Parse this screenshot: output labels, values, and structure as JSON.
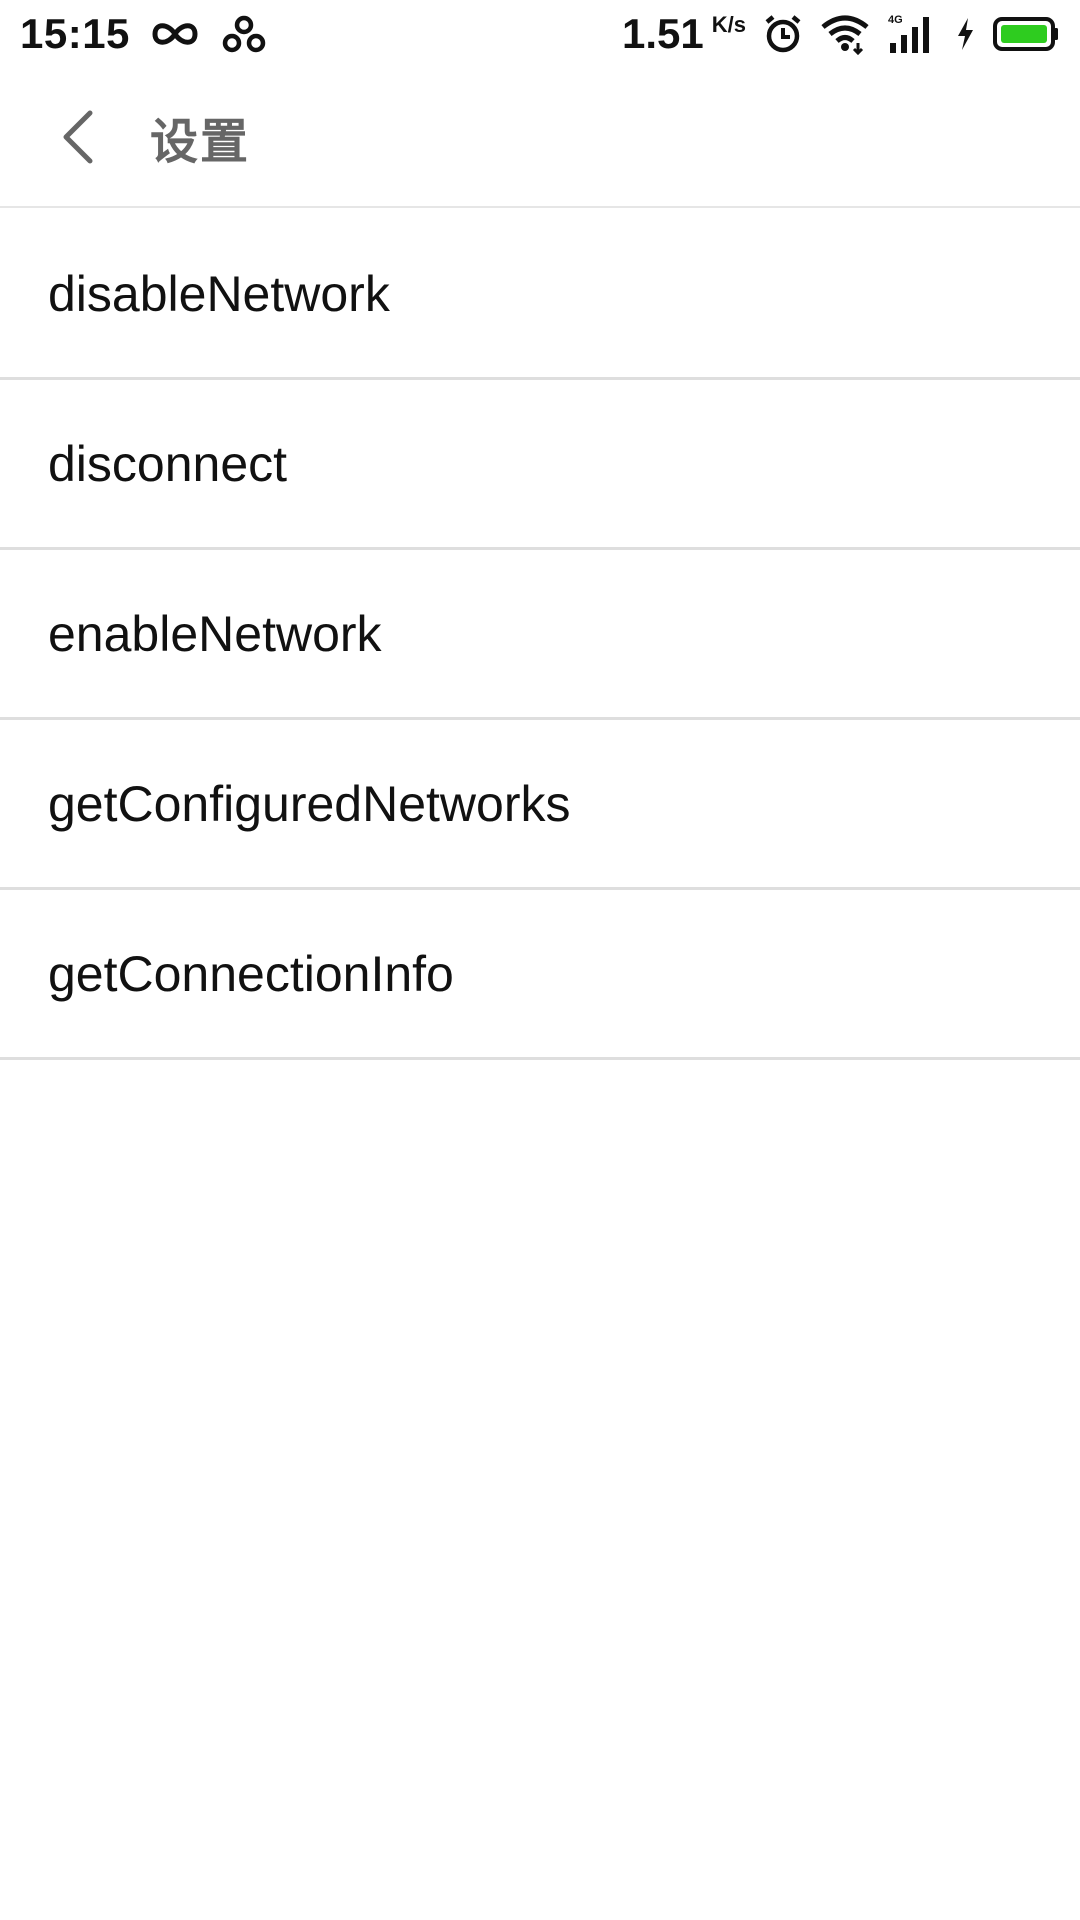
{
  "status_bar": {
    "time": "15:15",
    "net_speed_value": "1.51",
    "net_speed_unit": "K/s",
    "network_type": "4G",
    "battery_color": "#2ecc1f",
    "icons": [
      "infinity-icon",
      "link-icon",
      "alarm-icon",
      "wifi-icon",
      "signal-icon",
      "charging-icon",
      "battery-icon"
    ]
  },
  "header": {
    "title": "设置",
    "back_icon": "chevron-left-icon"
  },
  "list": {
    "items": [
      {
        "label": "disableNetwork"
      },
      {
        "label": "disconnect"
      },
      {
        "label": "enableNetwork"
      },
      {
        "label": "getConfiguredNetworks"
      },
      {
        "label": "getConnectionInfo"
      }
    ]
  }
}
